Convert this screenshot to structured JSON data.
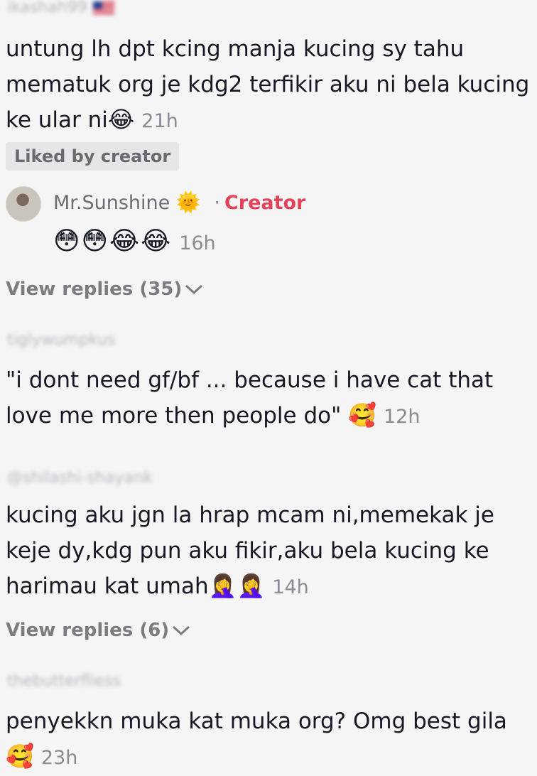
{
  "comments": [
    {
      "username": "ikashah99",
      "text": "untung lh dpt kcing manja kucing sy tahu mematuk org je kdg2 terfikir aku ni bela kucing ke ular ni",
      "emoji": "😂",
      "time": "21h",
      "liked_badge": "Liked by creator"
    },
    {
      "username": "tiglywumpkus",
      "text": "\"i dont need gf/bf ... because i have cat that love me more then people do\" ",
      "emoji": "🥰",
      "time": "12h"
    },
    {
      "username": "@shilashi-shayank",
      "text": "kucing aku jgn la hrap mcam ni,memekak je keje dy,kdg pun aku fikir,aku bela kucing ke harimau kat umah",
      "emoji": "🤦‍♀️🤦‍♀️",
      "time": "14h",
      "view_replies": "View replies (6)"
    },
    {
      "username": "thebutterfliess",
      "text": "penyekkn muka kat muka org? Omg best gila ",
      "emoji": "🥰",
      "time": "23h"
    }
  ],
  "creator_reply": {
    "name": "Mr.Sunshine",
    "name_emoji": "🌞",
    "separator": "·",
    "tag": "Creator",
    "emojis": "😳😳😂😂",
    "time": "16h",
    "view_replies": "View replies (35)"
  },
  "icons": {
    "chevron": "chevron-down-icon"
  },
  "colors": {
    "background": "#f6f5f6",
    "creator_tag": "#e0435a",
    "secondary_text": "#8a8b91"
  }
}
